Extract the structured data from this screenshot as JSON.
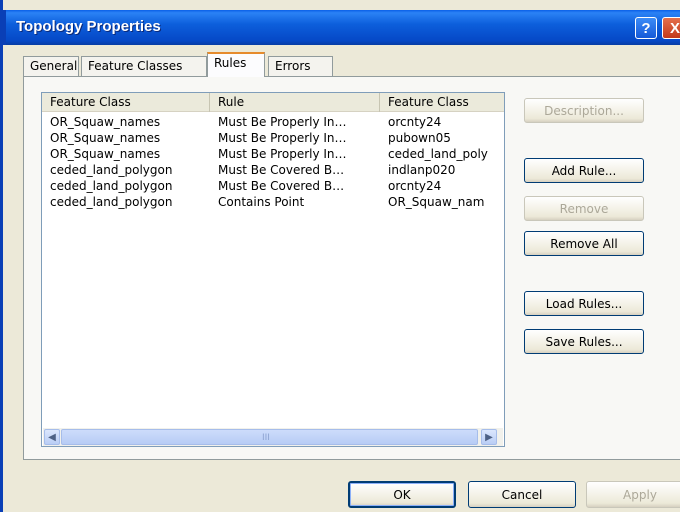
{
  "window": {
    "title": "Topology Properties"
  },
  "titlebar": {
    "help_label": "?",
    "close_label": "X"
  },
  "tabs": [
    {
      "label": "General"
    },
    {
      "label": "Feature Classes"
    },
    {
      "label": "Rules",
      "active": true
    },
    {
      "label": "Errors"
    }
  ],
  "list": {
    "columns": [
      "Feature Class",
      "Rule",
      "Feature Class"
    ],
    "rows": [
      [
        "OR_Squaw_names",
        "Must Be Properly In…",
        "orcnty24"
      ],
      [
        "OR_Squaw_names",
        "Must Be Properly In…",
        "pubown05"
      ],
      [
        "OR_Squaw_names",
        "Must Be Properly In…",
        "ceded_land_poly"
      ],
      [
        "ceded_land_polygon",
        "Must Be Covered B…",
        "indlanp020"
      ],
      [
        "ceded_land_polygon",
        "Must Be Covered B…",
        "orcnty24"
      ],
      [
        "ceded_land_polygon",
        "Contains Point",
        "OR_Squaw_nam"
      ]
    ],
    "scroll_left_arrow": "◀",
    "scroll_right_arrow": "▶",
    "grip": "III"
  },
  "side_buttons": {
    "description": "Description...",
    "add_rule": "Add Rule...",
    "remove": "Remove",
    "remove_all": "Remove All",
    "load_rules": "Load Rules...",
    "save_rules": "Save Rules..."
  },
  "footer": {
    "ok": "OK",
    "cancel": "Cancel",
    "apply": "Apply"
  },
  "colors": {
    "titlebar": "#0d5fdc",
    "dialog_bg": "#ece9d8",
    "close_btn": "#c2391a",
    "tab_highlight": "#e68b2c"
  }
}
